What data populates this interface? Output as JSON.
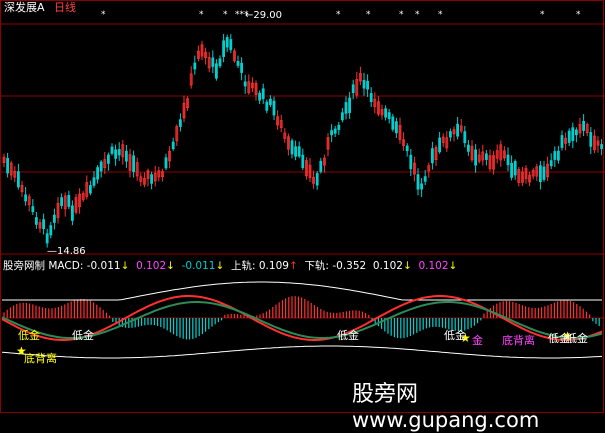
{
  "header": {
    "stock_name": "深发展A",
    "period": "日线",
    "high_marker": "←29.00",
    "low_marker": "—14.86",
    "stars": [
      "*",
      "*",
      "*",
      "***",
      "*",
      "*",
      "*",
      "*",
      "*",
      "*",
      "*"
    ]
  },
  "indicator": {
    "name": "股旁网制",
    "macd_label": "MACD:",
    "macd_values": [
      {
        "text": "-0.011",
        "arrow": "↓",
        "color": "#ffffff"
      },
      {
        "text": "0.102",
        "arrow": "↓",
        "color": "#ff44ff"
      },
      {
        "text": "-0.011",
        "arrow": "↓",
        "color": "#00cccc"
      }
    ],
    "upper_label": "上轨:",
    "upper_value": "0.109",
    "upper_arrow": "↑",
    "lower_label": "下轨:",
    "lower_value": "-0.352",
    "tail_values": [
      {
        "text": "0.102",
        "arrow": "↓",
        "color": "#ffffff"
      },
      {
        "text": "0.102",
        "arrow": "↓",
        "color": "#ff44ff"
      }
    ],
    "signals": [
      "低金",
      "低金",
      "低金",
      "低金",
      "底背离",
      "金",
      "底背离",
      "低金",
      "低金"
    ]
  },
  "watermark": {
    "cn": "股旁网",
    "url": "www.gupang.com"
  },
  "colors": {
    "up": "#ff3030",
    "down": "#00d0d0",
    "grid": "#8b0000",
    "signal_yellow": "#ffff00",
    "signal_pink": "#ff44ff"
  }
}
